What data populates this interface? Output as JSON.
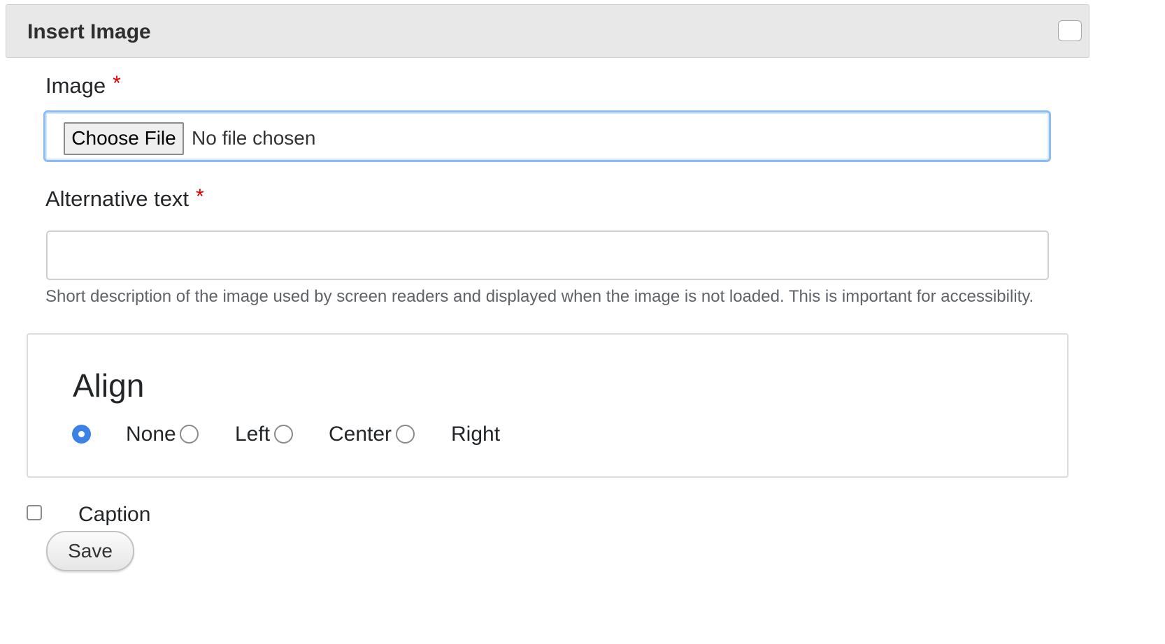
{
  "dialog": {
    "title": "Insert Image"
  },
  "form": {
    "image_label": "Image",
    "required_mark": "*",
    "file_input": {
      "button_label": "Choose File",
      "status": "No file chosen"
    },
    "alt_label": "Alternative text",
    "alt_value": "",
    "alt_help": "Short description of the image used by screen readers and displayed when the image is not loaded. This is important for accessibility.",
    "align": {
      "legend": "Align",
      "options": [
        {
          "label": "None",
          "checked": true
        },
        {
          "label": "Left",
          "checked": false
        },
        {
          "label": "Center",
          "checked": false
        },
        {
          "label": "Right",
          "checked": false
        }
      ]
    },
    "caption_label": "Caption",
    "caption_checked": false,
    "save_label": "Save"
  },
  "colors": {
    "header_bg": "#e8e8e8",
    "required": "#e00000",
    "focus_border": "#8dbcf2",
    "radio_checked": "#3b82e6"
  }
}
